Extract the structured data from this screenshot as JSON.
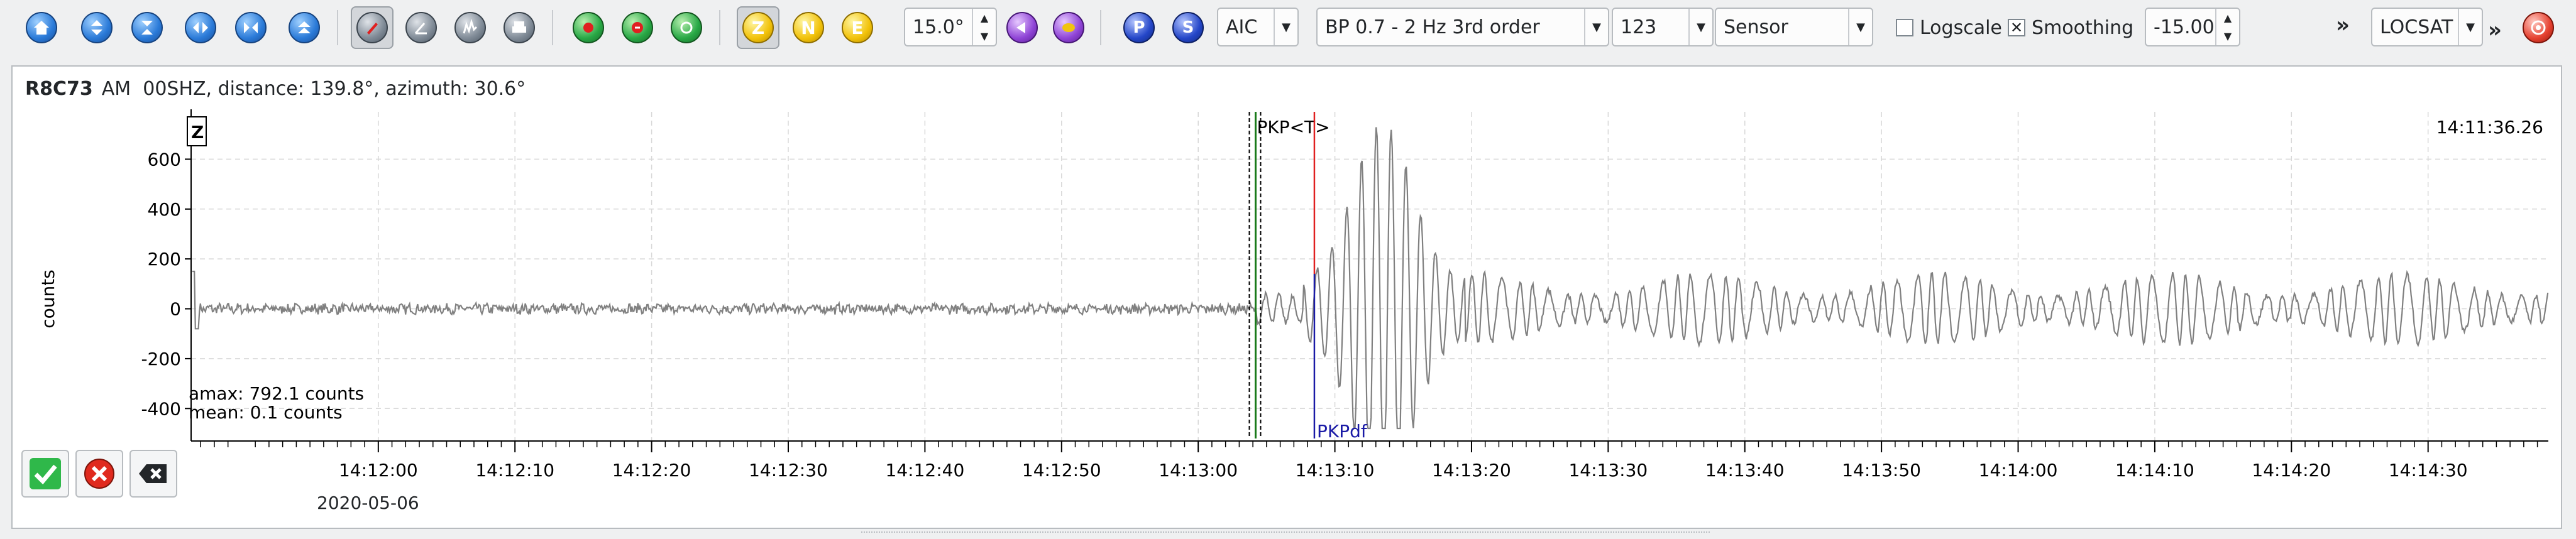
{
  "toolbar": {
    "zoom_value": "15.0°",
    "picker_method": "AIC",
    "filter": "BP 0.7 - 2 Hz  3rd order",
    "components_mode": "123",
    "amplitude_unit": "Sensor",
    "logscale_label": "Logscale",
    "logscale_checked": false,
    "smoothing_label": "Smoothing",
    "smoothing_checked": true,
    "offset_value": "-15.00",
    "more_glyph": "»",
    "locator": "LOCSAT",
    "more2_glyph": "»",
    "component_letters": {
      "z": "Z",
      "n": "N",
      "e": "E"
    },
    "phase_letters": {
      "p": "P",
      "s": "S"
    }
  },
  "trace": {
    "station": "R8C73",
    "network": "AM",
    "info": "00SHZ, distance: 139.8°, azimuth: 30.6°",
    "component_tag": "Z",
    "time_label": "14:11:36.26",
    "y_axis_label": "counts",
    "amax": "amax: 792.1 counts",
    "mean": "mean: 0.1 counts",
    "date_label": "2020-05-06",
    "theoretical_pick": "PKP<T>",
    "manual_pick": "PKPdf"
  },
  "chart_data": {
    "type": "line",
    "title": "",
    "xlabel": "",
    "ylabel": "counts",
    "y_ticks": [
      -400,
      -200,
      0,
      200,
      400,
      600
    ],
    "ylim": [
      -490,
      790
    ],
    "x_ticks": [
      "14:12:00",
      "14:12:10",
      "14:12:20",
      "14:12:30",
      "14:12:40",
      "14:12:50",
      "14:13:00",
      "14:13:10",
      "14:13:20",
      "14:13:30",
      "14:13:40",
      "14:13:50",
      "14:14:00",
      "14:14:10",
      "14:14:20",
      "14:14:30"
    ],
    "xlim_seconds_after_14_11_00": [
      46.3,
      218.8
    ],
    "pick_theoretical_seconds_after_14_11_00": 124.2,
    "pick_manual_seconds_after_14_11_00": 128.5,
    "pick_red_marker_seconds_after_14_11_00": 128.5,
    "grid": true,
    "series": [
      {
        "name": "",
        "color": "#808080"
      }
    ]
  },
  "colors": {
    "trace": "#808080",
    "pick_manual": "#1a1aa6",
    "pick_red": "#e02020",
    "pick_theoretical": "#1a7a1a",
    "grid": "#d8d8d8"
  }
}
